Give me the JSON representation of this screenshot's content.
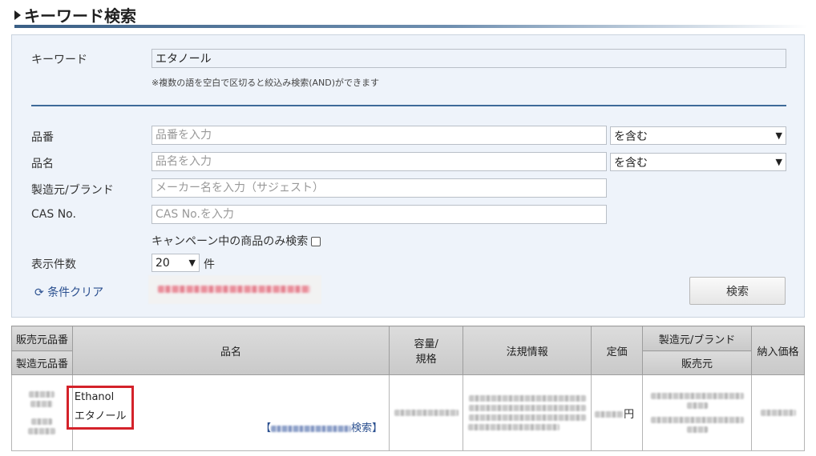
{
  "header": {
    "title": "キーワード検索"
  },
  "form": {
    "keyword_label": "キーワード",
    "keyword_value": "エタノール",
    "keyword_note": "※複数の語を空白で区切ると絞込み検索(AND)ができます",
    "part_label": "品番",
    "part_placeholder": "品番を入力",
    "part_match": "を含む",
    "name_label": "品名",
    "name_placeholder": "品名を入力",
    "name_match": "を含む",
    "maker_label": "製造元/ブランド",
    "maker_placeholder": "メーカー名を入力（サジェスト）",
    "cas_label": "CAS No.",
    "cas_placeholder": "CAS No.を入力",
    "campaign_label": "キャンペーン中の商品のみ検索",
    "count_label": "表示件数",
    "count_value": "20",
    "count_unit": "件",
    "clear_label": "条件クリア",
    "search_button": "検索"
  },
  "table": {
    "headers": {
      "sales_no": "販売元品番",
      "maker_no": "製造元品番",
      "name": "品名",
      "capacity": "容量/\n規格",
      "regulation": "法規情報",
      "list_price": "定価",
      "maker": "製造元/ブランド",
      "seller": "販売元",
      "delivery_price": "納入価格"
    },
    "rows": [
      {
        "name_en": "Ethanol",
        "name_ja": "エタノール",
        "link_open": "【",
        "link_suffix": "検索】",
        "price_unit": "円"
      }
    ]
  },
  "colors": {
    "accent_blue": "#2a4f8f",
    "panel_bg": "#eef3fa",
    "highlight_red": "#d4222a"
  },
  "icons": {
    "clear": "refresh-icon",
    "title_marker": "triangle-right-icon",
    "dropdown": "chevron-down-icon"
  }
}
